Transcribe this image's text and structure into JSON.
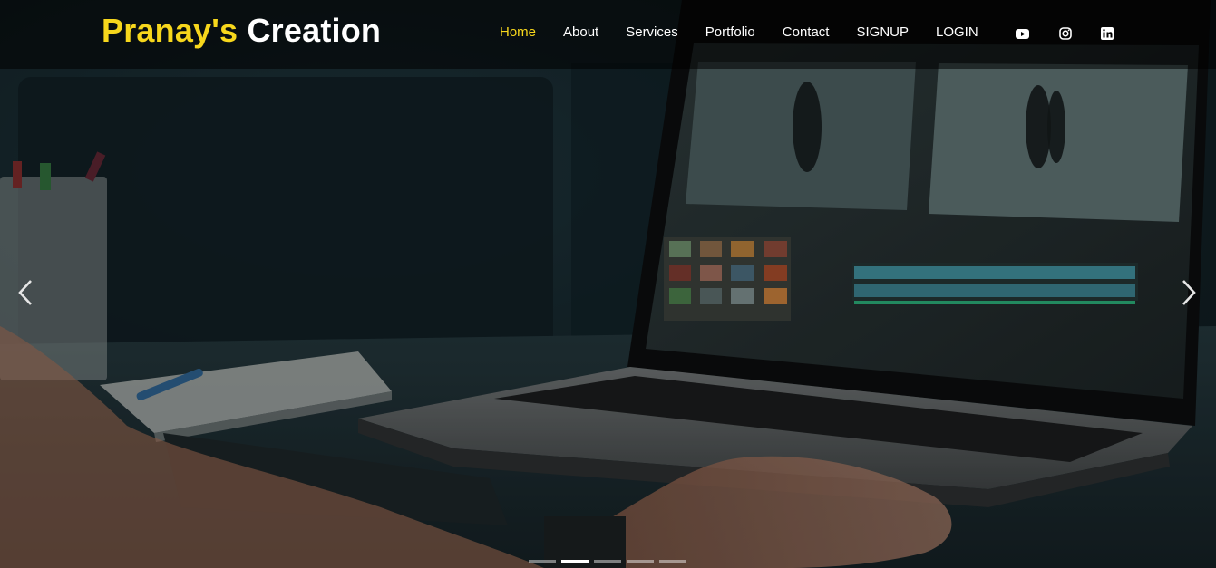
{
  "brand": {
    "part1": "Pranay's",
    "part2": " Creation",
    "accent_color": "#f7d71c"
  },
  "nav": {
    "items": [
      {
        "label": "Home",
        "active": true
      },
      {
        "label": "About"
      },
      {
        "label": "Services"
      },
      {
        "label": "Portfolio"
      },
      {
        "label": "Contact"
      },
      {
        "label": "SIGNUP"
      },
      {
        "label": "LOGIN"
      }
    ],
    "social_icons": [
      "youtube-icon",
      "instagram-icon",
      "linkedin-icon"
    ]
  },
  "carousel": {
    "slide_count": 5,
    "active_index": 1,
    "prev_icon": "chevron-left-icon",
    "next_icon": "chevron-right-icon"
  }
}
